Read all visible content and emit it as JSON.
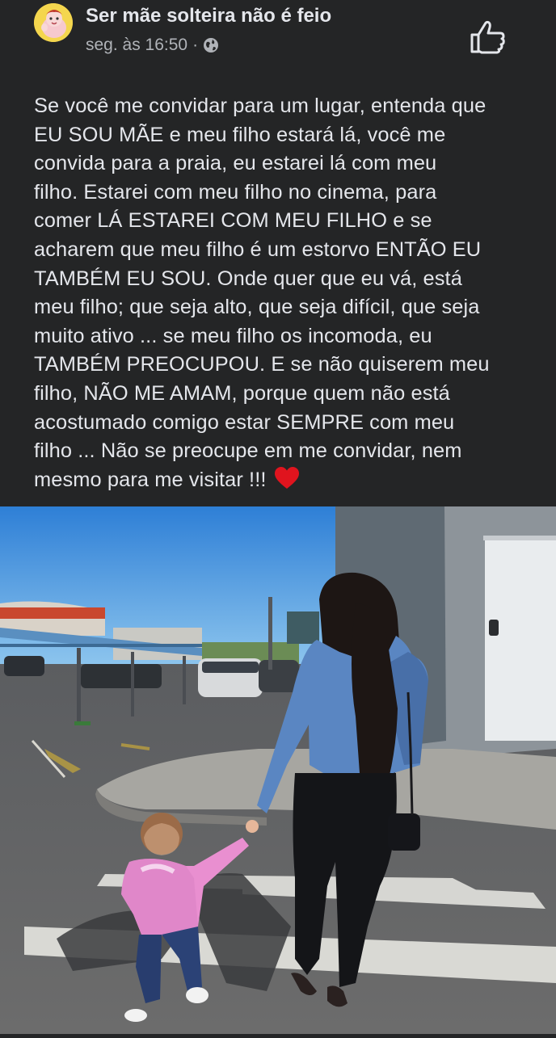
{
  "post": {
    "page_name": "Ser mãe solteira não é feio",
    "timestamp": "seg. às 16:50",
    "separator": "·",
    "privacy_icon": "globe-icon",
    "like_icon": "thumbs-up-icon",
    "text_lines": [
      "Se você me convidar para um lugar, entenda que",
      "EU SOU MÃE e meu filho estará lá, você me",
      "convida para a praia, eu estarei lá com meu",
      "filho. Estarei com meu filho no cinema, para",
      "comer LÁ ESTAREI COM MEU FILHO e se",
      "acharem que meu filho é um estorvo ENTÃO EU",
      "TAMBÉM EU SOU. Onde quer que eu vá, está",
      "meu filho; que seja alto, que seja difícil, que seja",
      "muito ativo ... se meu filho os incomoda, eu",
      "TAMBÉM PREOCUPOU. E se não quiserem meu",
      "filho, NÃO ME AMAM, porque quem não está",
      "acostumado comigo estar SEMPRE com meu",
      "filho ... Não se preocupe em me convidar, nem",
      "mesmo para me visitar !!!"
    ],
    "emoji": "heart",
    "colors": {
      "background": "#242526",
      "text": "#e4e6eb",
      "secondary": "#b0b3b8",
      "heart": "#e0141e"
    }
  }
}
